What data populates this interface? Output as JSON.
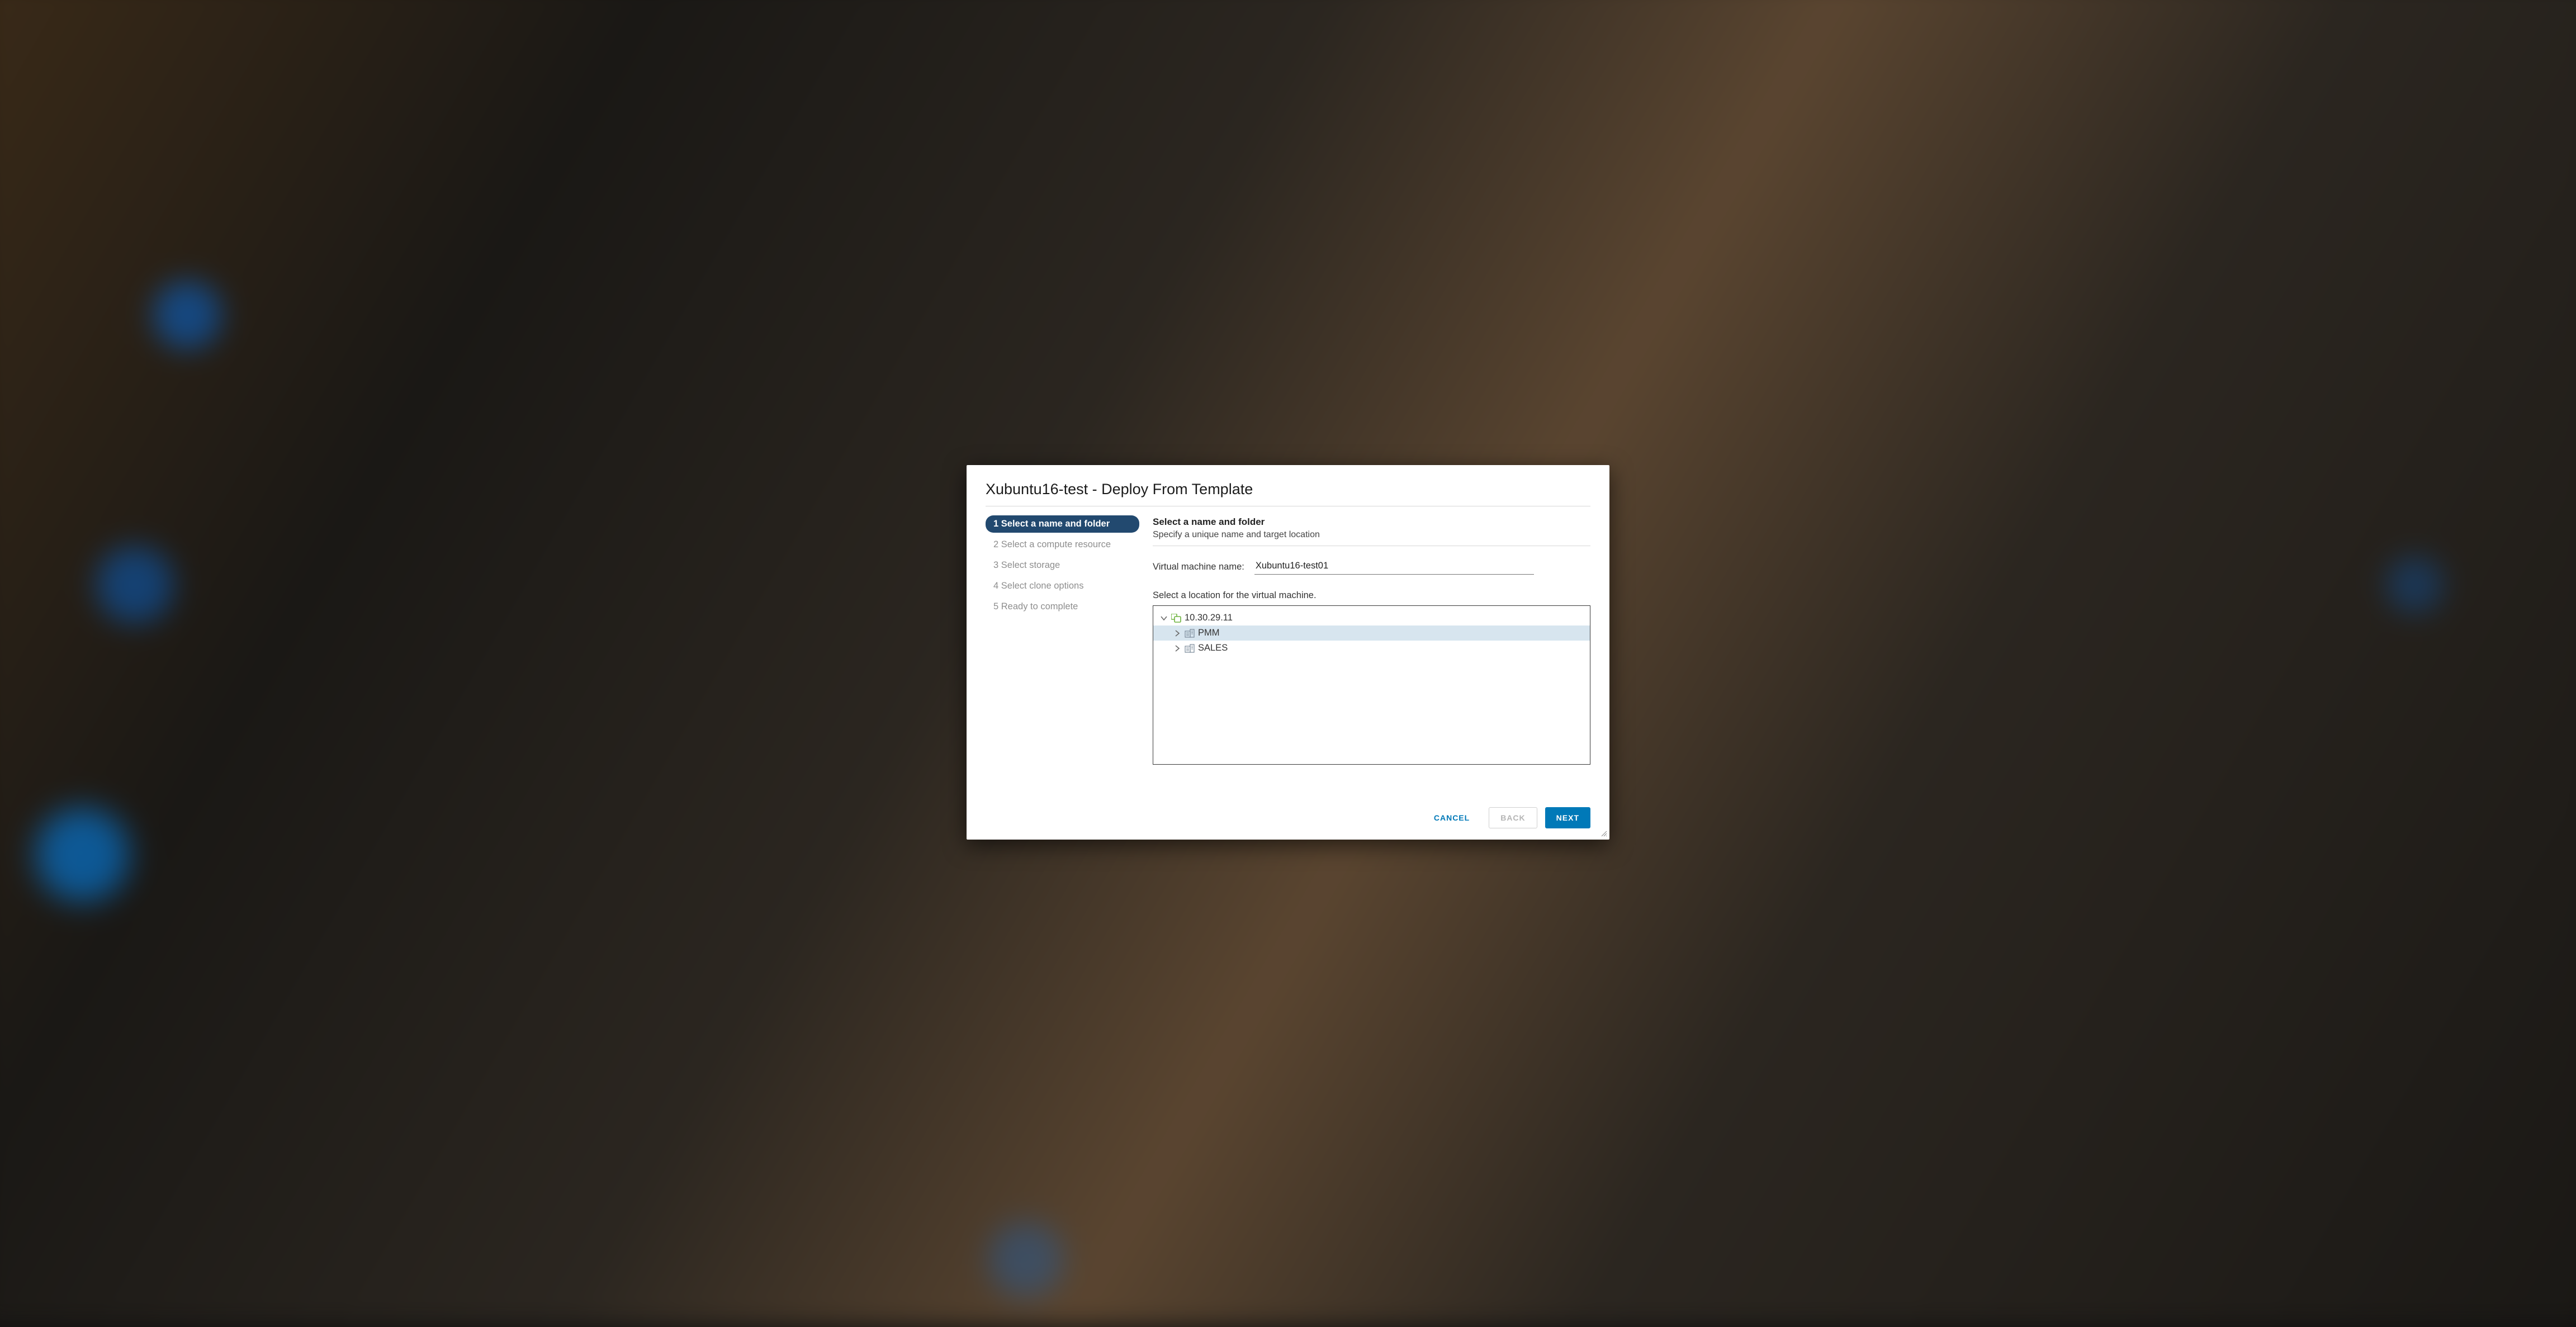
{
  "title": "Xubuntu16-test - Deploy From Template",
  "steps": [
    {
      "label": "1 Select a name and folder",
      "active": true
    },
    {
      "label": "2 Select a compute resource",
      "active": false
    },
    {
      "label": "3 Select storage",
      "active": false
    },
    {
      "label": "4 Select clone options",
      "active": false
    },
    {
      "label": "5 Ready to complete",
      "active": false
    }
  ],
  "section": {
    "title": "Select a name and folder",
    "subtitle": "Specify a unique name and target location"
  },
  "vm_name": {
    "label": "Virtual machine name:",
    "value": "Xubuntu16-test01"
  },
  "location": {
    "label": "Select a location for the virtual machine.",
    "tree": {
      "root": {
        "label": "10.30.29.11",
        "expanded": true
      },
      "children": [
        {
          "label": "PMM",
          "selected": true
        },
        {
          "label": "SALES",
          "selected": false
        }
      ]
    }
  },
  "buttons": {
    "cancel": "CANCEL",
    "back": "BACK",
    "next": "NEXT"
  }
}
